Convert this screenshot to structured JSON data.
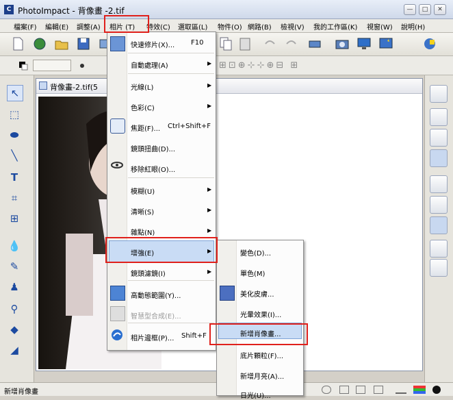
{
  "window": {
    "title": "PhotoImpact - 背像畫 -2.tif",
    "minimize_label": "—",
    "maximize_label": "□",
    "close_label": "✕"
  },
  "menubar": {
    "items": [
      {
        "label": "檔案(F)"
      },
      {
        "label": "編輯(E)"
      },
      {
        "label": "調整(A)"
      },
      {
        "label": "相片 (T)"
      },
      {
        "label": "特效(C)"
      },
      {
        "label": "選取區(L)"
      },
      {
        "label": "物件(O)"
      },
      {
        "label": "網路(B)"
      },
      {
        "label": "檢視(V)"
      },
      {
        "label": "我的工作區(K)"
      },
      {
        "label": "視窗(W)"
      },
      {
        "label": "說明(H)"
      }
    ]
  },
  "document": {
    "title": "背像畫-2.tif(5"
  },
  "photo_menu": {
    "items": [
      {
        "label": "快速修片(X)...",
        "shortcut": "F10",
        "arrow": ""
      },
      {
        "label": "自動處理(A)",
        "shortcut": "",
        "arrow": "▶"
      },
      {
        "label": "光線(L)",
        "shortcut": "",
        "arrow": "▶"
      },
      {
        "label": "色彩(C)",
        "shortcut": "",
        "arrow": "▶"
      },
      {
        "label": "焦距(F)...",
        "shortcut": "Ctrl+Shift+F",
        "arrow": ""
      },
      {
        "label": "鏡頭扭曲(D)...",
        "shortcut": "",
        "arrow": ""
      },
      {
        "label": "移除紅眼(O)...",
        "shortcut": "",
        "arrow": ""
      },
      {
        "label": "模糊(U)",
        "shortcut": "",
        "arrow": "▶"
      },
      {
        "label": "清晰(S)",
        "shortcut": "",
        "arrow": "▶"
      },
      {
        "label": "雜點(N)",
        "shortcut": "",
        "arrow": "▶"
      },
      {
        "label": "增強(E)",
        "shortcut": "",
        "arrow": "▶"
      },
      {
        "label": "鏡頭濾鏡(I)",
        "shortcut": "",
        "arrow": "▶"
      },
      {
        "label": "高動態範圍(Y)...",
        "shortcut": "",
        "arrow": ""
      },
      {
        "label": "智慧型合成(E)...",
        "shortcut": "",
        "arrow": ""
      },
      {
        "label": "相片邊框(P)...",
        "shortcut": "Shift+F",
        "arrow": ""
      }
    ]
  },
  "enhance_submenu": {
    "items": [
      {
        "label": "變色(D)..."
      },
      {
        "label": "單色(M)"
      },
      {
        "label": "美化皮膚..."
      },
      {
        "label": "光暈效果(I)..."
      },
      {
        "label": "新增肖像畫..."
      },
      {
        "label": "底片顆粒(F)..."
      },
      {
        "label": "新增月亮(A)..."
      },
      {
        "label": "日光(U)..."
      }
    ]
  },
  "statusbar": {
    "text": "新增肖像畫"
  },
  "colors": {
    "highlight_border": "#e0201b",
    "accent_blue": "#1c4aa0"
  }
}
